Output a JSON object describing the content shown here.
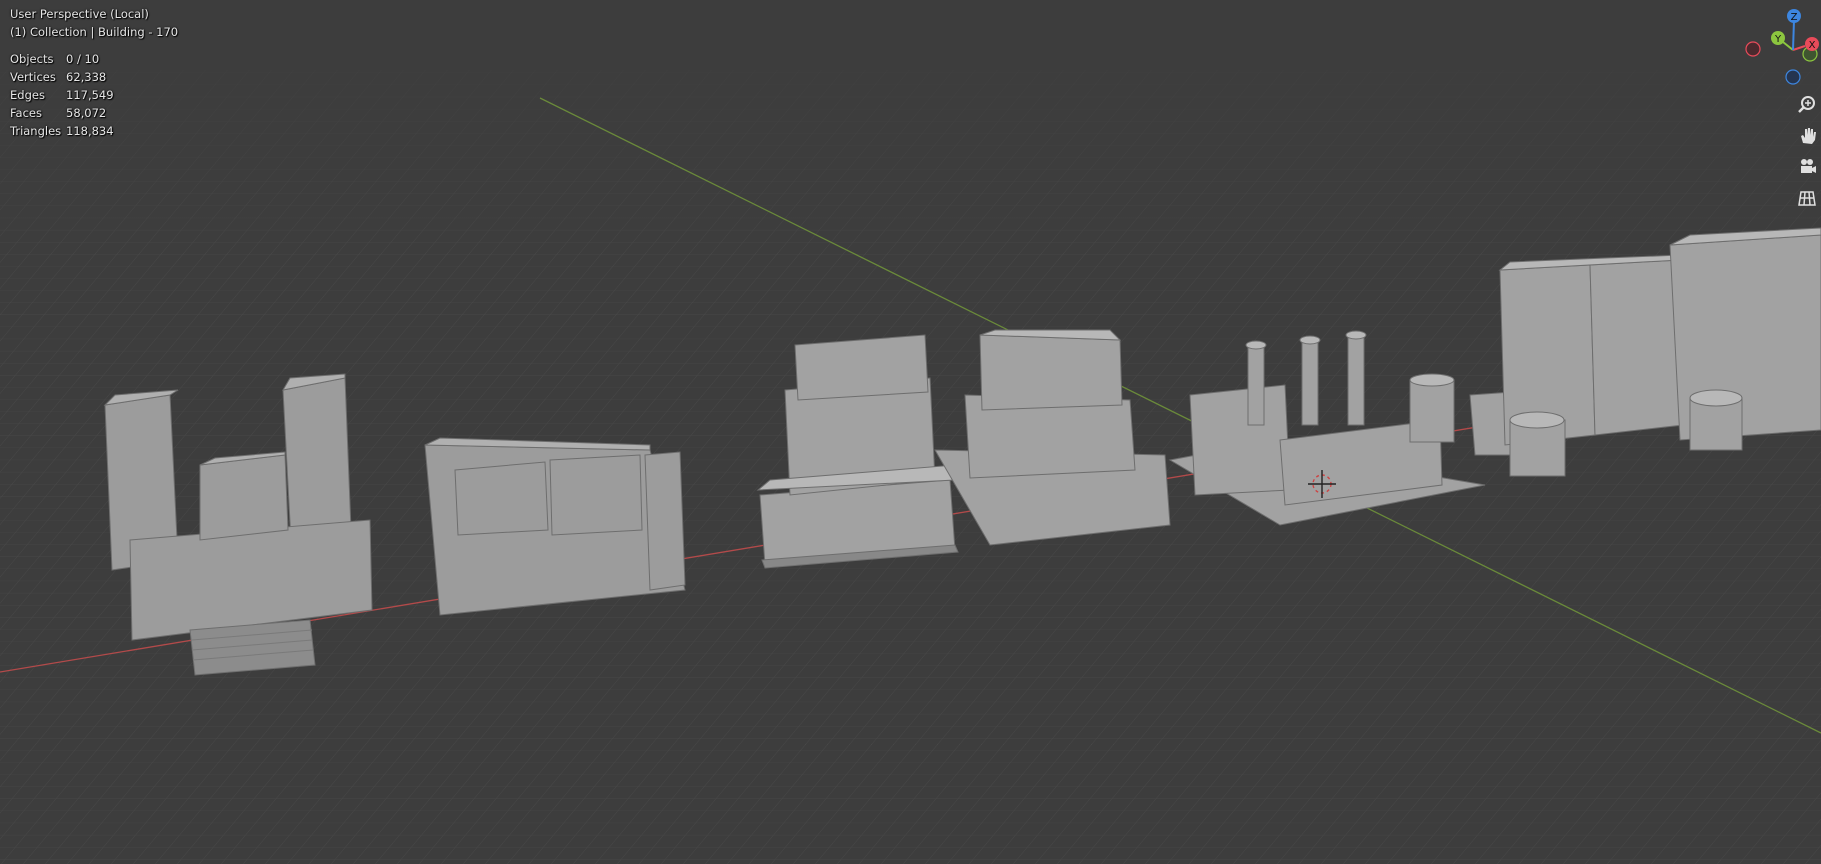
{
  "viewport": {
    "header_line1": "User Perspective (Local)",
    "header_line2": "(1) Collection | Building - 170"
  },
  "stats": [
    {
      "label": "Objects",
      "value": "0 / 10"
    },
    {
      "label": "Vertices",
      "value": "62,338"
    },
    {
      "label": "Edges",
      "value": "117,549"
    },
    {
      "label": "Faces",
      "value": "58,072"
    },
    {
      "label": "Triangles",
      "value": "118,834"
    }
  ],
  "gizmo": {
    "axis_x": "X",
    "axis_y": "Y",
    "axis_z": "Z",
    "colors": {
      "x": "#e94b5a",
      "y": "#8cc63f",
      "z": "#3d86e0"
    }
  },
  "tools": [
    {
      "name": "zoom-icon"
    },
    {
      "name": "hand-pan-icon"
    },
    {
      "name": "camera-icon"
    },
    {
      "name": "grid-ortho-icon"
    }
  ],
  "colors": {
    "background": "#3d3d3d",
    "grid": "#4a4a4a",
    "x_axis": "#b34a4a",
    "y_axis": "#6a8a3a",
    "building": "#9a9a9a"
  }
}
